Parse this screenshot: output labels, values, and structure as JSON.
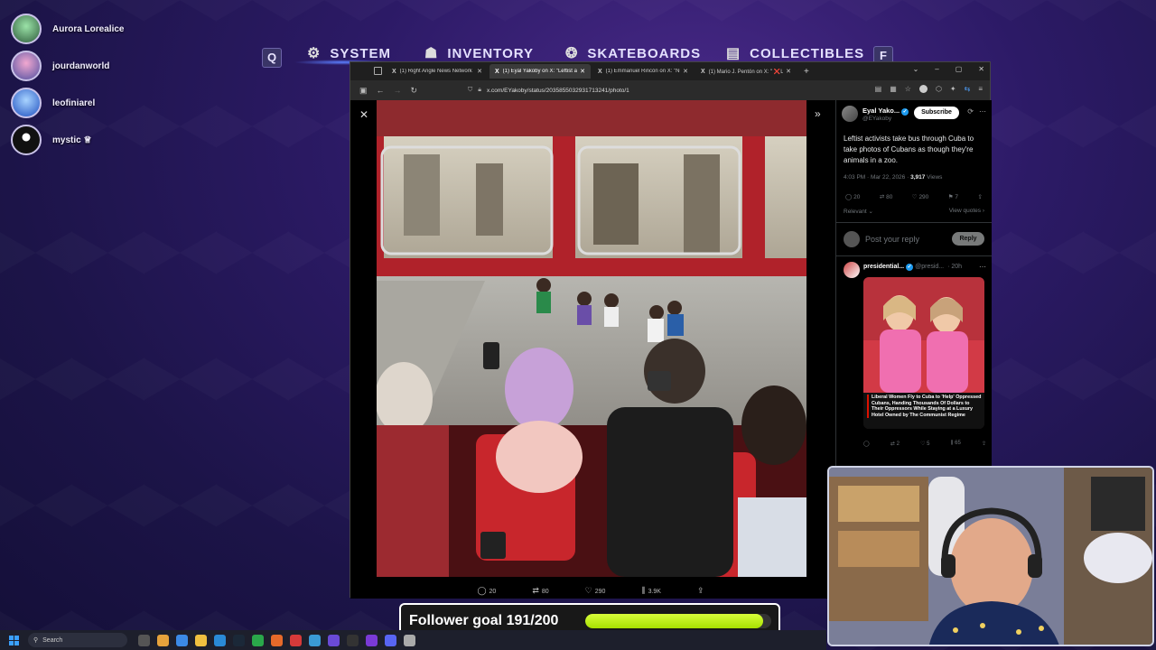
{
  "viewers": [
    {
      "name": "Aurora Lorealice",
      "color": "#3d6b4a"
    },
    {
      "name": "jourdanworld",
      "color": "#5a5fa0"
    },
    {
      "name": "leofiniarel",
      "color": "#2b5fc9"
    },
    {
      "name": "mystic ♕",
      "color": "#111111"
    }
  ],
  "game_nav": {
    "left_key": "Q",
    "right_key": "F",
    "items": [
      {
        "label": "SYSTEM",
        "icon": "⚙"
      },
      {
        "label": "INVENTORY",
        "icon": "☗"
      },
      {
        "label": "SKATEBOARDS",
        "icon": "❂"
      },
      {
        "label": "COLLECTIBLES",
        "icon": "▤"
      }
    ]
  },
  "browser": {
    "tabs": [
      {
        "label": "(1) Right Angle News Network",
        "active": false
      },
      {
        "label": "(1) Eyal Yakoby on X: \"Leftist ac",
        "active": true
      },
      {
        "label": "(1) Emmanuel Rincón on X: \"Nu",
        "active": false
      },
      {
        "label": "(1) Mario J. Pentón on X: \" ❌Lo",
        "active": false
      }
    ],
    "url": "x.com/EYakoby/status/2035855032931713241/photo/1"
  },
  "media_actions": {
    "replies": "20",
    "reposts": "80",
    "likes": "290",
    "views": "3.9K"
  },
  "tweet": {
    "author_name": "Eyal Yako...",
    "handle": "@EYakoby",
    "subscribe_label": "Subscribe",
    "text": "Leftist activists take bus through Cuba to take photos of Cubans as though they're animals in a zoo.",
    "time": "4:03 PM · Mar 22, 2026 ·",
    "views_count": "3,917",
    "views_label": "Views",
    "stats": {
      "replies": "20",
      "reposts": "80",
      "likes": "290",
      "bookmarks": "7"
    },
    "sort_label": "Relevant ⌄",
    "view_quotes": "View quotes ›",
    "reply_placeholder": "Post your reply",
    "reply_button": "Reply"
  },
  "reply_tweet": {
    "name": "presidential...",
    "handle": "@presid...",
    "time": "· 20h",
    "caption": "Liberal Women Fly to Cuba to 'Help' Oppressed Cubans, Handing Thousands Of Dollars to Their Oppressors While Staying at a Luxury Hotel Owned by The Communist Regime",
    "stats": {
      "replies": "",
      "reposts": "2",
      "likes": "5",
      "views": "65"
    }
  },
  "follower_goal": {
    "label": "Follower goal 191/200",
    "current": 191,
    "target": 200
  },
  "taskbar": {
    "search_placeholder": "Search"
  }
}
